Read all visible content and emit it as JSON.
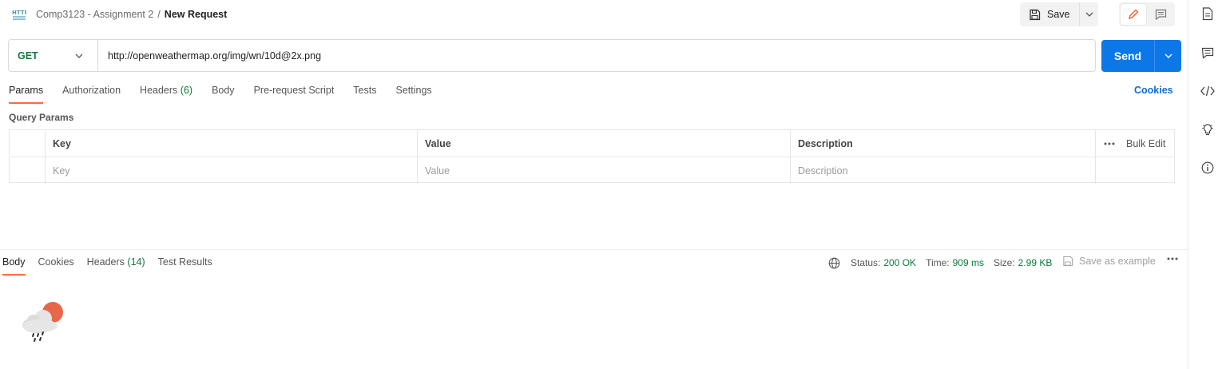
{
  "header": {
    "icon": "http-icon",
    "breadcrumb_parent": "Comp3123 - Assignment 2",
    "breadcrumb_separator": "/",
    "breadcrumb_current": "New Request",
    "save_label": "Save"
  },
  "request": {
    "method": "GET",
    "url": "http://openweathermap.org/img/wn/10d@2x.png",
    "send_label": "Send"
  },
  "request_tabs": [
    {
      "label": "Params",
      "count": ""
    },
    {
      "label": "Authorization",
      "count": ""
    },
    {
      "label": "Headers",
      "count": "(6)"
    },
    {
      "label": "Body",
      "count": ""
    },
    {
      "label": "Pre-request Script",
      "count": ""
    },
    {
      "label": "Tests",
      "count": ""
    },
    {
      "label": "Settings",
      "count": ""
    }
  ],
  "cookies_label": "Cookies",
  "query_params": {
    "title": "Query Params",
    "columns": [
      "Key",
      "Value",
      "Description"
    ],
    "bulk_edit": "Bulk Edit",
    "placeholders": [
      "Key",
      "Value",
      "Description"
    ]
  },
  "response": {
    "tabs": [
      {
        "label": "Body",
        "count": ""
      },
      {
        "label": "Cookies",
        "count": ""
      },
      {
        "label": "Headers",
        "count": "(14)"
      },
      {
        "label": "Test Results",
        "count": ""
      }
    ],
    "status_label": "Status:",
    "status_value": "200 OK",
    "time_label": "Time:",
    "time_value": "909 ms",
    "size_label": "Size:",
    "size_value": "2.99 KB",
    "save_example": "Save as example"
  },
  "colors": {
    "accent": "#ff6c37",
    "send": "#0c78e8",
    "method_get": "#0b7a3e",
    "status_ok": "#0b7a3e",
    "link": "#0c6fd1"
  }
}
